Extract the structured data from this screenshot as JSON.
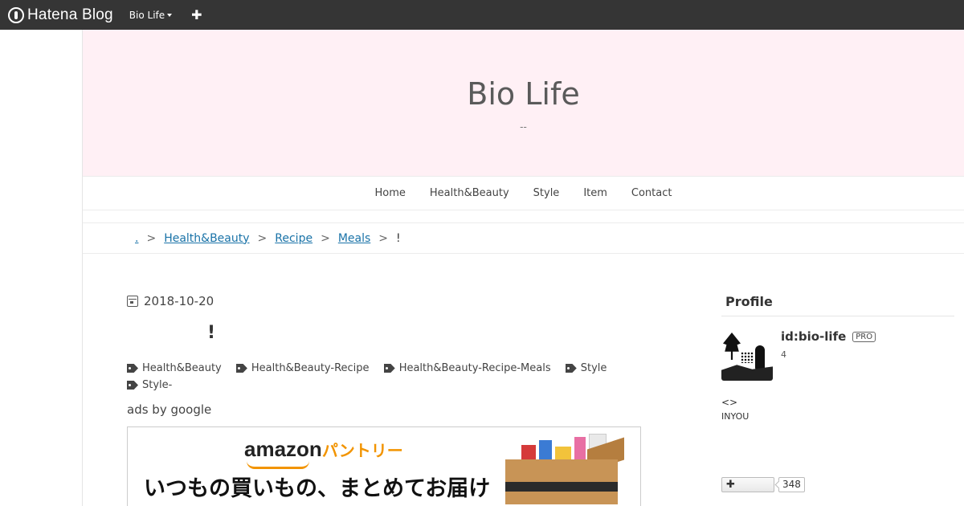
{
  "topbar": {
    "logo_text": "Hatena Blog",
    "blog_menu_label": "Bio Life",
    "add_label": "✚"
  },
  "header": {
    "title": "Bio Life",
    "description": "--"
  },
  "nav": {
    "items": [
      "Home",
      "Health&Beauty",
      "Style",
      "Item",
      "Contact"
    ]
  },
  "breadcrumb": {
    "home_label": ".",
    "sep": ">",
    "items": [
      "Health&Beauty",
      "Recipe",
      "Meals"
    ],
    "current": "!"
  },
  "entry": {
    "date": "2018-10-20",
    "title": "!",
    "tags": [
      "Health&Beauty",
      "Health&Beauty-Recipe",
      "Health&Beauty-Recipe-Meals",
      "Style",
      "Style-"
    ],
    "ads_label": "ads by google"
  },
  "ad": {
    "brand": "amazon",
    "brand_sub": "パントリー",
    "copy": "いつもの買いもの、まとめてお届け"
  },
  "sidebar": {
    "title": "Profile",
    "profile_id": "id:bio-life",
    "pro_badge": "PRO",
    "count": "4",
    "text1": "<>",
    "text2": "INYOU",
    "follow_label": "✚",
    "follow_count": "348"
  }
}
